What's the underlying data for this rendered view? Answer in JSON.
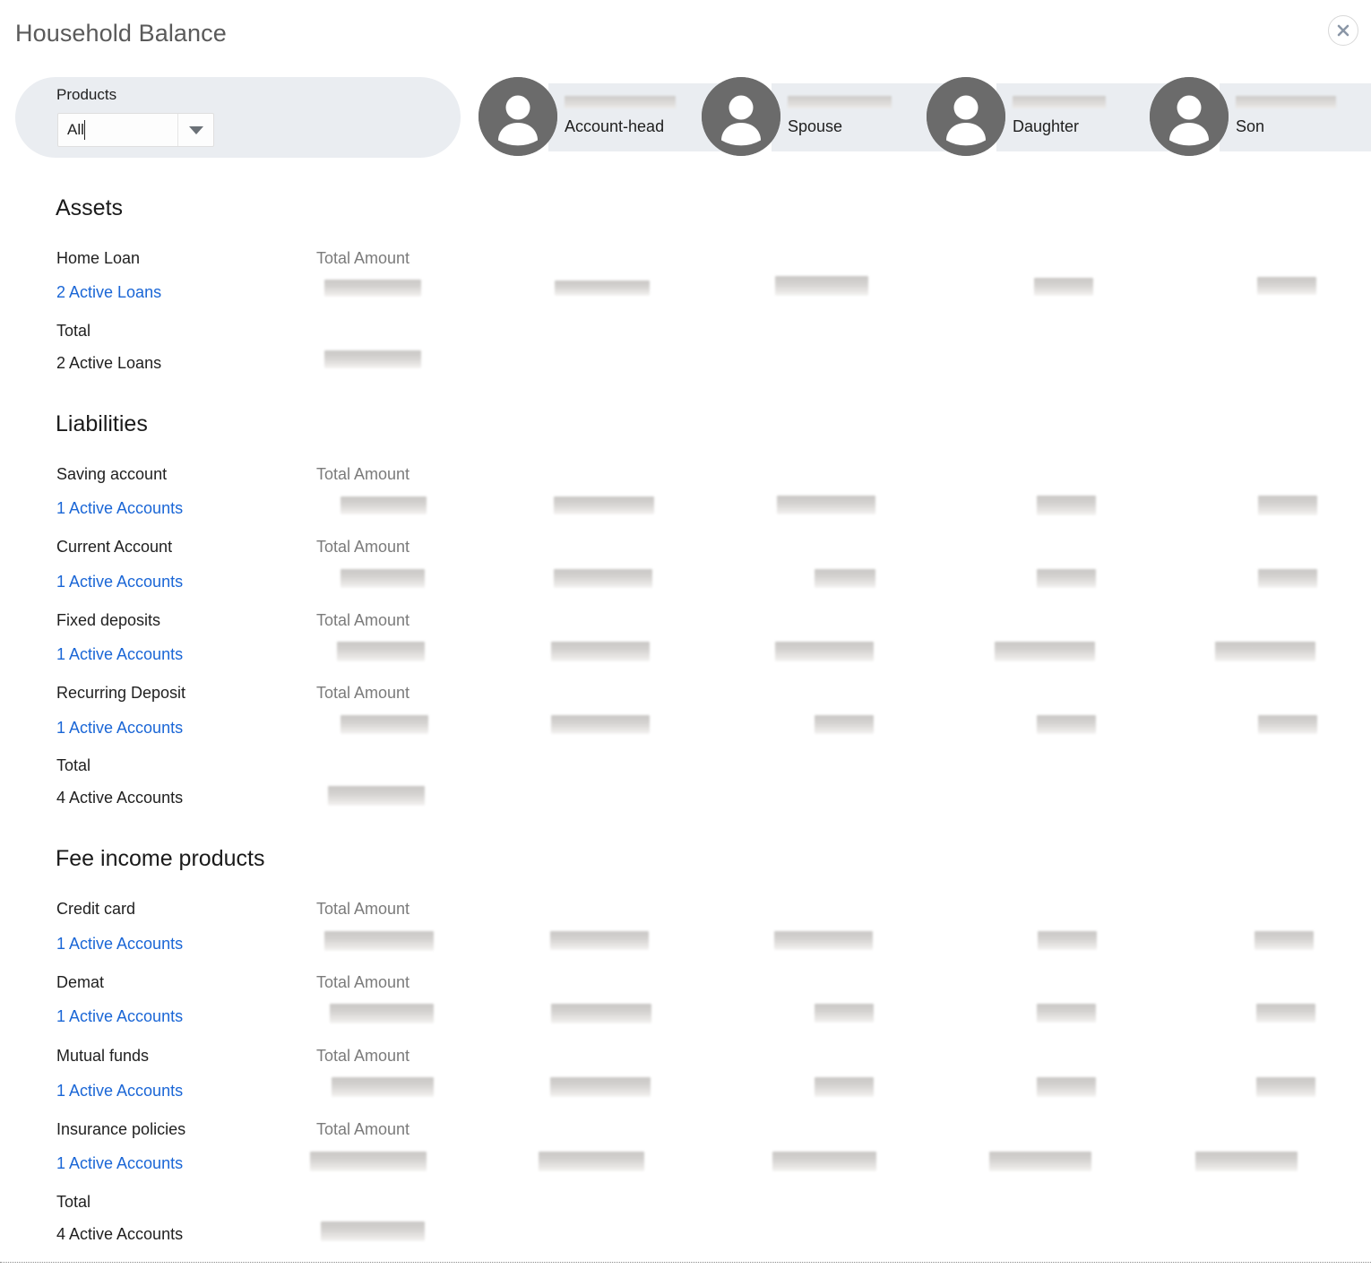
{
  "window": {
    "title": "Household Balance",
    "close_icon": "close-icon",
    "close_label": "Close"
  },
  "filter": {
    "label": "Products",
    "value": "All",
    "placeholder": "All",
    "caret_icon": "chevron-down-icon",
    "options": [
      "All"
    ]
  },
  "personas": [
    {
      "role": "Account-head",
      "avatar_icon": "person-avatar-icon",
      "name_redacted": true,
      "redact_width": 124
    },
    {
      "role": "Spouse",
      "avatar_icon": "person-avatar-icon",
      "name_redacted": true,
      "redact_width": 116
    },
    {
      "role": "Daughter",
      "avatar_icon": "person-avatar-icon",
      "name_redacted": true,
      "redact_width": 104
    },
    {
      "role": "Son",
      "avatar_icon": "person-avatar-icon",
      "name_redacted": true,
      "redact_width": 112
    }
  ],
  "column_header": "Total Amount",
  "sections": [
    {
      "title": "Assets",
      "rows": [
        {
          "product": "Home Loan",
          "amount_header": "Total Amount",
          "accounts_link": "2 Active Loans"
        }
      ],
      "total": {
        "label": "Total",
        "accounts": "2 Active Loans"
      }
    },
    {
      "title": "Liabilities",
      "rows": [
        {
          "product": "Saving account",
          "amount_header": "Total Amount",
          "accounts_link": "1 Active Accounts"
        },
        {
          "product": "Current Account",
          "amount_header": "Total Amount",
          "accounts_link": "1 Active Accounts"
        },
        {
          "product": "Fixed deposits",
          "amount_header": "Total Amount",
          "accounts_link": "1 Active Accounts"
        },
        {
          "product": "Recurring Deposit",
          "amount_header": "Total Amount",
          "accounts_link": "1 Active Accounts"
        }
      ],
      "total": {
        "label": "Total",
        "accounts": "4 Active Accounts"
      }
    },
    {
      "title": "Fee income products",
      "rows": [
        {
          "product": "Credit card",
          "amount_header": "Total Amount",
          "accounts_link": "1 Active Accounts"
        },
        {
          "product": "Demat",
          "amount_header": "Total Amount",
          "accounts_link": "1 Active Accounts"
        },
        {
          "product": "Mutual funds",
          "amount_header": "Total Amount",
          "accounts_link": "1 Active Accounts"
        },
        {
          "product": "Insurance policies",
          "amount_header": "Total Amount",
          "accounts_link": "1 Active Accounts"
        }
      ],
      "total": {
        "label": "Total",
        "accounts": "4 Active Accounts"
      }
    }
  ],
  "colors": {
    "link": "#1a66d6",
    "pill_background": "#eaedf1",
    "avatar": "#6b6b6b",
    "muted_text": "#7b7b7b",
    "title_text": "#5a5a5a"
  },
  "redaction": {
    "note": "All monetary values and member names are masked/blurred in this screenshot"
  }
}
